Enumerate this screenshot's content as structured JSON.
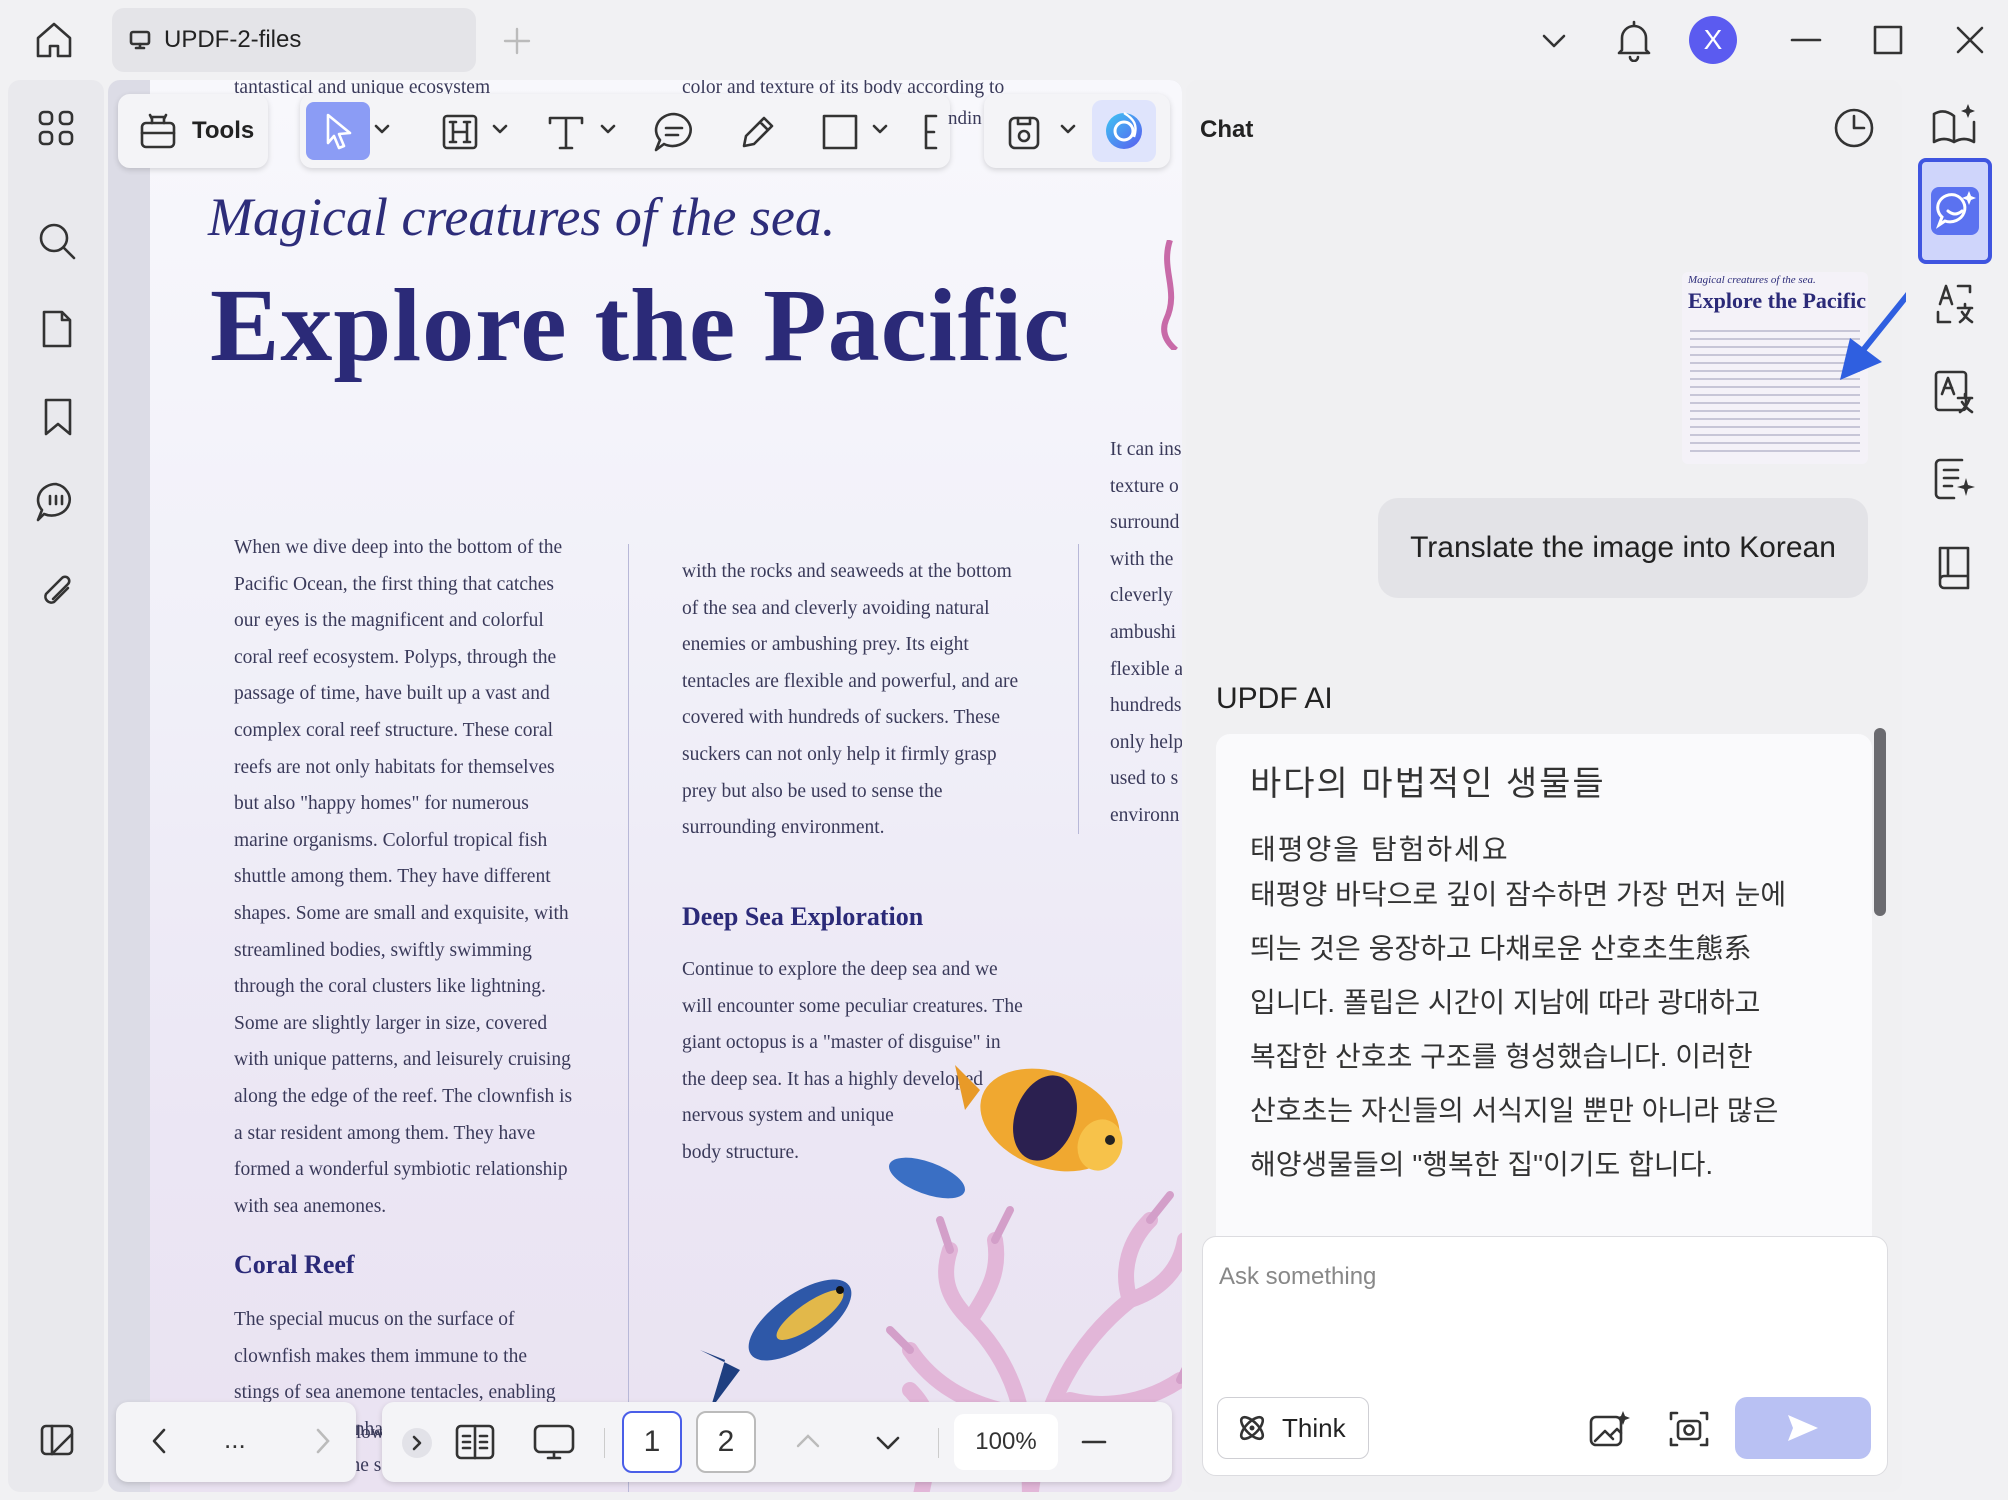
{
  "window": {
    "tab_title": "UPDF-2-files",
    "avatar_initial": "X",
    "colors": {
      "accent": "#4a5ee8",
      "title_blue": "#2b2a78",
      "send_disabled": "#b9c1f3"
    }
  },
  "toolbar": {
    "tools_label": "Tools",
    "cropped_text": "ndin"
  },
  "document": {
    "top_line_left": "tantastical and unique ecosystem",
    "top_line_mid": "color and texture of its body according to",
    "subtitle": "Magical creatures of the sea.",
    "title": "Explore the Pacific",
    "col1_lines": [
      "When we dive deep into the bottom of the",
      "Pacific Ocean, the first thing that catches",
      "our eyes is the magnificent and colorful",
      "coral reef ecosystem. Polyps, through the",
      "passage of time, have built up a vast and",
      "complex coral reef structure. These coral",
      "reefs are not only habitats for themselves",
      "but also \"happy homes\" for numerous",
      "marine organisms. Colorful tropical fish",
      "shuttle among them. They have different",
      "shapes. Some are small and exquisite, with",
      "streamlined bodies, swiftly swimming",
      "through the coral clusters like lightning.",
      "Some are slightly larger in size, covered",
      "with unique patterns, and leisurely cruising",
      "along the edge of the reef. The clownfish is",
      "a star resident among them. They have",
      "formed a wonderful symbiotic relationship",
      "with sea anemones."
    ],
    "coral_heading": "Coral Reef",
    "coral_lines": [
      " The special mucus on the surface of",
      "clownfish makes them immune to the",
      "stings of sea anemone tentacles, enabling",
      "them to safely inhabit among the sea",
      "anemones. At the same time, the"
    ],
    "col2_lines": [
      "with the rocks and seaweeds at the bottom",
      "of the sea and cleverly avoiding natural",
      "enemies or ambushing prey. Its eight",
      "tentacles are flexible and powerful, and are",
      "covered with hundreds of suckers. These",
      "suckers can not only help it firmly grasp",
      "prey but also be used to sense the",
      "surrounding environment."
    ],
    "deep_heading": "Deep Sea Exploration",
    "deep_lines": [
      "Continue to explore the deep sea and we",
      "will encounter some peculiar creatures. The",
      "giant octopus is a \"master of disguise\" in",
      "the deep sea. It has a highly developed",
      "nervous system and unique",
      "body structure."
    ],
    "col3_lines": [
      "It can ins",
      "texture o",
      "surround",
      "with the",
      "cleverly",
      "ambushi",
      "flexible a",
      "hundreds",
      "only help",
      "used to s",
      "environn"
    ],
    "hidden_low_text": "low"
  },
  "bottom_bar": {
    "more_label": "...",
    "page_1": "1",
    "page_2": "2",
    "zoom": "100%"
  },
  "chat": {
    "title": "Chat",
    "thumb_subtitle": "Magical creatures of the sea.",
    "thumb_title": "Explore the Pacific",
    "user_message": "Translate the image into Korean",
    "ai_label": "UPDF AI",
    "ai_heading": "바다의 마법적인 생물들",
    "ai_subheading": "태평양을 탐험하세요",
    "ai_lines": [
      "태평양 바닥으로 깊이 잠수하면 가장 먼저 눈에",
      "띄는 것은 웅장하고 다채로운 산호초生態系",
      "입니다. 폴립은 시간이 지남에 따라 광대하고",
      "복잡한 산호초 구조를 형성했습니다. 이러한",
      "산호초는 자신들의 서식지일 뿐만 아니라 많은",
      "해양생물들의 \"행복한 집\"이기도 합니다."
    ],
    "ask_placeholder": "Ask something",
    "think_label": "Think"
  }
}
